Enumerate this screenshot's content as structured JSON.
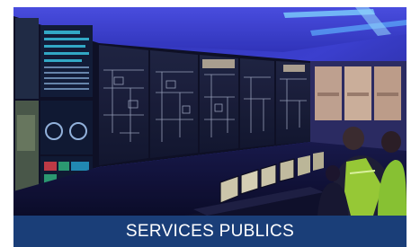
{
  "card": {
    "caption": "SERVICES PUBLICS",
    "caption_bg": "#1a3e78",
    "photo_subject": "control-room-video-wall"
  }
}
